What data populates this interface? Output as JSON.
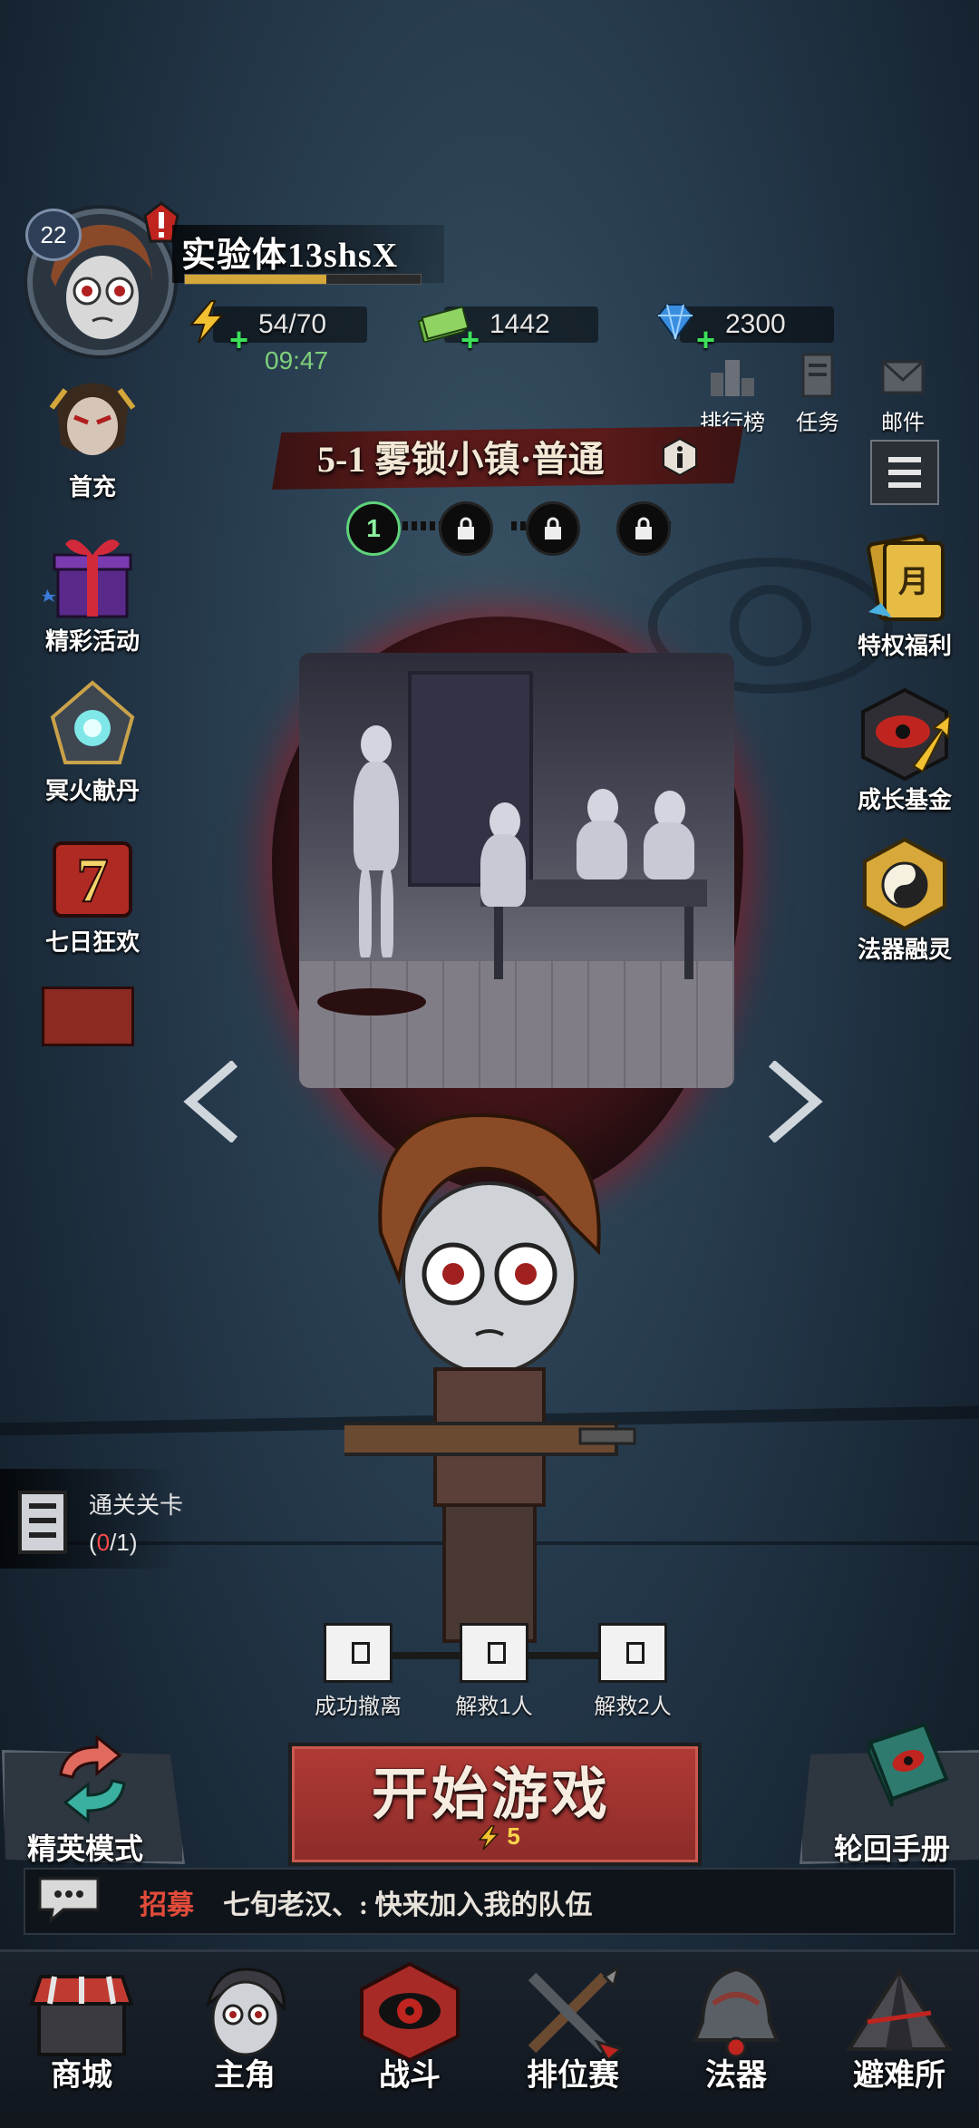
{
  "player": {
    "level": "22",
    "name": "实验体13shsX",
    "xp_fraction": 0.6
  },
  "resources": {
    "stamina": "54/70",
    "cash": "1442",
    "gems": "2300",
    "timer": "09:47"
  },
  "top_buttons": {
    "ranking": "排行榜",
    "tasks": "任务",
    "mail": "邮件"
  },
  "left_menu": {
    "first_charge": "首充",
    "events": "精彩活动",
    "offering": "冥火献丹",
    "seven_day": "七日狂欢"
  },
  "right_menu": {
    "privilege": "特权福利",
    "growth_fund": "成长基金",
    "artifact_fusion": "法器融灵"
  },
  "stage": {
    "title": "5-1 雾锁小镇·普通",
    "current_step": "1"
  },
  "clear": {
    "label": "通关关卡",
    "open": "(",
    "done": "0",
    "close": "/1)"
  },
  "chests": {
    "c1": "成功撤离",
    "c2": "解救1人",
    "c3": "解救2人"
  },
  "actions": {
    "start": "开始游戏",
    "start_cost": "5",
    "elite": "精英模式",
    "handbook": "轮回手册"
  },
  "chat": {
    "channel": "招募",
    "message": "七旬老汉、: 快来加入我的队伍"
  },
  "nav": {
    "shop": "商城",
    "hero": "主角",
    "battle": "战斗",
    "ranked": "排位赛",
    "artifact": "法器",
    "shelter": "避难所"
  },
  "colors": {
    "accent_red": "#b13a36",
    "stamina_green": "#7fd07b",
    "chat_channel": "#e14b3a"
  }
}
